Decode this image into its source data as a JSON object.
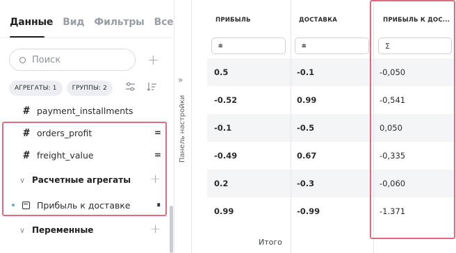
{
  "tabs": [
    {
      "label": "Данные",
      "active": true
    },
    {
      "label": "Вид",
      "active": false
    },
    {
      "label": "Фильтры",
      "active": false
    },
    {
      "label": "Все",
      "active": false
    }
  ],
  "search": {
    "placeholder": "Поиск",
    "value": ""
  },
  "chips": {
    "aggregates": "АГРЕГАТЫ: 1",
    "groups": "ГРУППЫ: 2"
  },
  "fields": [
    {
      "name": "payment_installments",
      "type_icon": "hash-icon"
    },
    {
      "name": "orders_profit",
      "type_icon": "hash-icon",
      "action": "="
    },
    {
      "name": "freight_value",
      "type_icon": "hash-icon",
      "action": "="
    }
  ],
  "sections": {
    "calculated": {
      "title": "Расчетные агрегаты"
    },
    "variables": {
      "title": "Переменные"
    }
  },
  "calculated_items": [
    {
      "name": "Прибыль к доставке",
      "action": "⏸"
    }
  ],
  "settings_panel": {
    "label": "Панель настройки",
    "expand_icon": "double-chevron-right-icon"
  },
  "table": {
    "columns": [
      {
        "header": "ПРИБЫЛЬ",
        "filter_icon": "filter-icon",
        "filter_label": "⩧"
      },
      {
        "header": "ДОСТАВКА",
        "filter_icon": "filter-icon",
        "filter_label": "⩧"
      },
      {
        "header": "ПРИБЫЛЬ К ДОС...",
        "filter_icon": "sum-icon",
        "filter_label": "Σ"
      }
    ],
    "rows": [
      [
        "0.5",
        "-0.1",
        "-0,050"
      ],
      [
        "-0.52",
        "0.99",
        "-0,541"
      ],
      [
        "-0.1",
        "-0.5",
        "0,050"
      ],
      [
        "-0.49",
        "0.67",
        "-0,335"
      ],
      [
        "0.2",
        "-0.3",
        "-0,060"
      ],
      [
        "0.99",
        "-0.99",
        "-1.371"
      ]
    ],
    "total_label": "Итого"
  },
  "colors": {
    "highlight": "#e06a80",
    "accent_dot": "#5bb0d6",
    "row_alt": "#f4f5f7"
  }
}
